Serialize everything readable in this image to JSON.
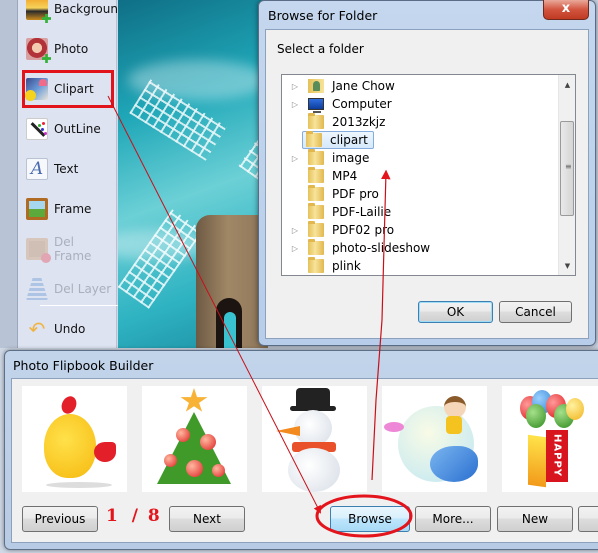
{
  "toolbar": {
    "items": [
      {
        "label": "Background",
        "icon": "background-add-icon",
        "enabled": true,
        "selected": false
      },
      {
        "label": "Photo",
        "icon": "photo-add-icon",
        "enabled": true,
        "selected": false
      },
      {
        "label": "Clipart",
        "icon": "clipart-icon",
        "enabled": true,
        "selected": true
      },
      {
        "label": "OutLine",
        "icon": "outline-icon",
        "enabled": true,
        "selected": false
      },
      {
        "label": "Text",
        "icon": "text-icon",
        "enabled": true,
        "selected": false
      },
      {
        "label": "Frame",
        "icon": "frame-icon",
        "enabled": true,
        "selected": false
      },
      {
        "label": "Del Frame",
        "icon": "delete-frame-icon",
        "enabled": false,
        "selected": false
      },
      {
        "label": "Del Layer",
        "icon": "delete-layer-icon",
        "enabled": false,
        "selected": false
      },
      {
        "label": "Undo",
        "icon": "undo-icon",
        "enabled": true,
        "selected": false
      }
    ]
  },
  "browse_dialog": {
    "title": "Browse for Folder",
    "close_glyph": "x",
    "prompt": "Select a folder",
    "folders": [
      {
        "name": "Jane Chow",
        "expandable": true,
        "icon": "user-folder-icon",
        "selected": false
      },
      {
        "name": "Computer",
        "expandable": true,
        "icon": "computer-icon",
        "selected": false
      },
      {
        "name": "2013zkjz",
        "expandable": false,
        "icon": "folder-icon",
        "selected": false
      },
      {
        "name": "clipart",
        "expandable": false,
        "icon": "folder-icon",
        "selected": true
      },
      {
        "name": "image",
        "expandable": true,
        "icon": "folder-icon",
        "selected": false
      },
      {
        "name": "MP4",
        "expandable": false,
        "icon": "folder-icon",
        "selected": false
      },
      {
        "name": "PDF pro",
        "expandable": false,
        "icon": "folder-icon",
        "selected": false
      },
      {
        "name": "PDF-Lailie",
        "expandable": false,
        "icon": "folder-icon",
        "selected": false
      },
      {
        "name": "PDF02 pro",
        "expandable": true,
        "icon": "folder-icon",
        "selected": false
      },
      {
        "name": "photo-slideshow",
        "expandable": true,
        "icon": "folder-icon",
        "selected": false
      },
      {
        "name": "plink",
        "expandable": false,
        "icon": "folder-icon",
        "selected": false
      }
    ],
    "ok_label": "OK",
    "cancel_label": "Cancel"
  },
  "flipbook": {
    "title": "Photo Flipbook Builder",
    "thumbnails": [
      {
        "name": "yellow-chick"
      },
      {
        "name": "christmas-tree"
      },
      {
        "name": "snowman"
      },
      {
        "name": "girl-on-bird"
      },
      {
        "name": "happy-balloons",
        "text": "HAPPY"
      }
    ],
    "page_current": "1",
    "page_separator": "/",
    "page_total": "8",
    "buttons": {
      "previous": "Previous",
      "next": "Next",
      "browse": "Browse",
      "more": "More...",
      "new": "New"
    }
  },
  "colors": {
    "annotation_red": "#e3141b"
  }
}
